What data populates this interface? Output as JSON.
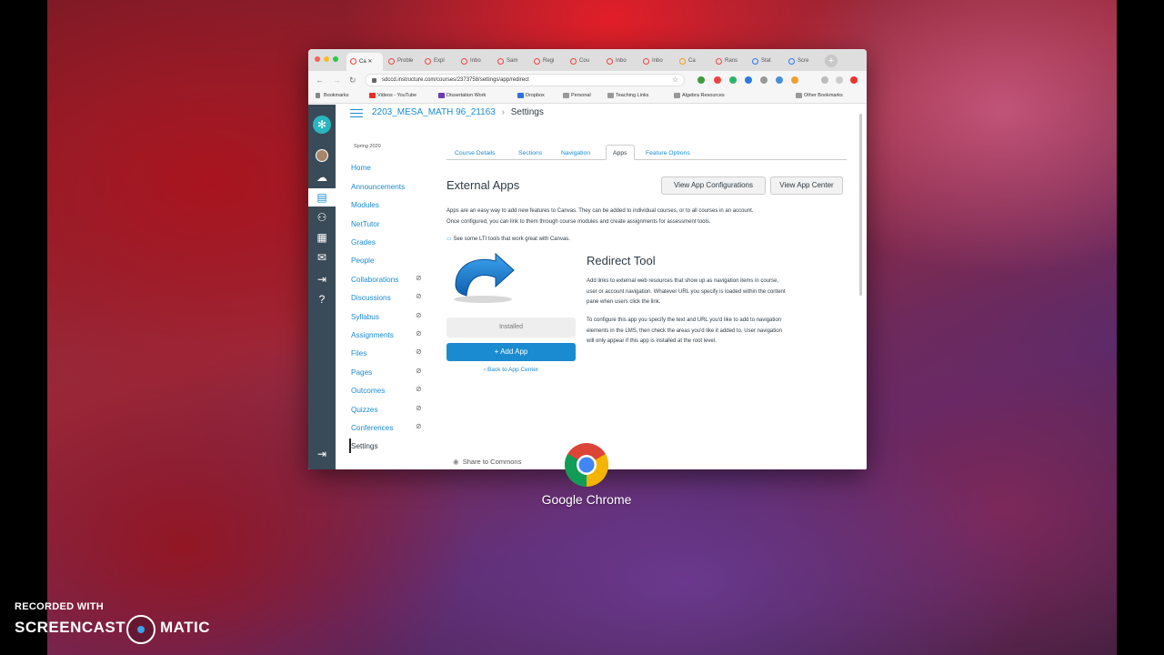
{
  "browser": {
    "tabs": [
      "Ca",
      "Proble",
      "Expl",
      "Inbo",
      "Sam",
      "Regi",
      "Cou",
      "Inbo",
      "Inbo",
      "Ca",
      "Rans",
      "Stat",
      "Scre"
    ],
    "url": "sdccd.instructure.com/courses/2373758/settings/app/redirect",
    "bookmarks": [
      "Bookmarks",
      "Videos - YouTube",
      "Dissertation Work",
      "Dropbox",
      "Personal",
      "Teaching Links",
      "Algebra Resources",
      "Other Bookmarks"
    ]
  },
  "canvas": {
    "breadcrumb": {
      "course": "2203_MESA_MATH 96_21163",
      "current": "Settings"
    },
    "term": "Spring 2020",
    "course_nav": [
      {
        "label": "Home",
        "hidden": false
      },
      {
        "label": "Announcements",
        "hidden": false
      },
      {
        "label": "Modules",
        "hidden": false
      },
      {
        "label": "NetTutor",
        "hidden": false
      },
      {
        "label": "Grades",
        "hidden": false
      },
      {
        "label": "People",
        "hidden": false
      },
      {
        "label": "Collaborations",
        "hidden": true
      },
      {
        "label": "Discussions",
        "hidden": true
      },
      {
        "label": "Syllabus",
        "hidden": true
      },
      {
        "label": "Assignments",
        "hidden": true
      },
      {
        "label": "Files",
        "hidden": true
      },
      {
        "label": "Pages",
        "hidden": true
      },
      {
        "label": "Outcomes",
        "hidden": true
      },
      {
        "label": "Quizzes",
        "hidden": true
      },
      {
        "label": "Conferences",
        "hidden": true
      },
      {
        "label": "Settings",
        "hidden": false
      }
    ],
    "settings_tabs": [
      "Course Details",
      "Sections",
      "Navigation",
      "Apps",
      "Feature Options"
    ],
    "active_tab": "Apps",
    "external_apps": {
      "heading": "External Apps",
      "btn_configurations": "View App Configurations",
      "btn_center": "View App Center",
      "description_lines": [
        "Apps are an easy way to add new features to Canvas. They can be added to individual courses, or to all courses in an account.",
        "Once configured, you can link to them through course modules and create assignments for assessment tools."
      ],
      "lti_link": "See some LTI tools that work great with Canvas."
    },
    "app": {
      "title": "Redirect Tool",
      "installed": "Installed",
      "add_app": "+ Add App",
      "back": "‹ Back to App Center",
      "description1": [
        "Add links to external web resources that show up as navigation items in course,",
        "user or account navigation. Whatever URL you specify is loaded within the content",
        "pane when users click the link."
      ],
      "description2": [
        "To configure this app you specify the text and URL you'd like to add to navigation",
        "elements in the LMS, then check the areas you'd like it added to. User navigation",
        "will only appear if this app is installed at the root level."
      ]
    },
    "share": "Share to Commons"
  },
  "dock_launch": {
    "label": "Google Chrome"
  },
  "watermark": {
    "line1": "RECORDED WITH",
    "word1": "SCREENCAST",
    "word2": "MATIC"
  },
  "colors": {
    "canvas_blue": "#1a8bd0",
    "nav_dark": "#394b58",
    "logo_teal": "#29b6c0"
  }
}
